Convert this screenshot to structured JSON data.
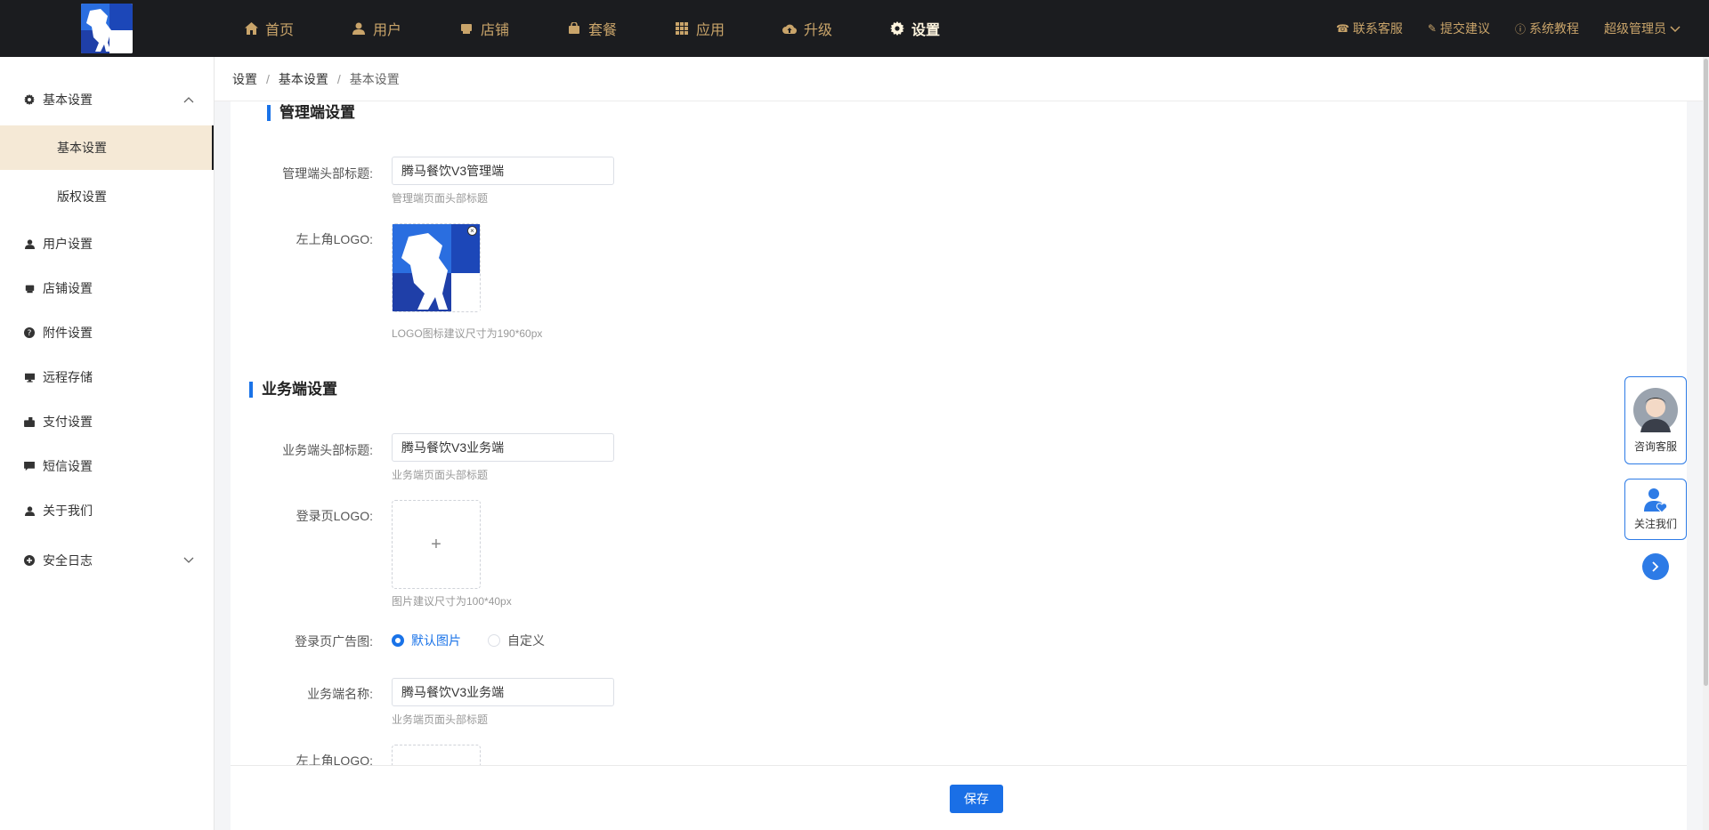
{
  "nav": {
    "items": [
      {
        "label": "首页",
        "icon": "home-icon"
      },
      {
        "label": "用户",
        "icon": "user-icon"
      },
      {
        "label": "店铺",
        "icon": "store-icon"
      },
      {
        "label": "套餐",
        "icon": "bag-icon"
      },
      {
        "label": "应用",
        "icon": "grid-icon"
      },
      {
        "label": "升级",
        "icon": "cloud-upload-icon"
      },
      {
        "label": "设置",
        "icon": "gear-icon",
        "active": true
      }
    ],
    "right": [
      {
        "label": "联系客服",
        "icon": "headset-icon"
      },
      {
        "label": "提交建议",
        "icon": "edit-icon"
      },
      {
        "label": "系统教程",
        "icon": "info-icon"
      }
    ],
    "user": "超级管理员"
  },
  "sidebar": {
    "groups": [
      {
        "label": "基本设置",
        "icon": "gear-icon",
        "expanded": true
      },
      {
        "label": "用户设置",
        "icon": "user-icon"
      },
      {
        "label": "店铺设置",
        "icon": "store-icon"
      },
      {
        "label": "附件设置",
        "icon": "question-icon"
      },
      {
        "label": "远程存储",
        "icon": "monitor-icon"
      },
      {
        "label": "支付设置",
        "icon": "wallet-icon"
      },
      {
        "label": "短信设置",
        "icon": "message-icon"
      },
      {
        "label": "关于我们",
        "icon": "user-icon"
      },
      {
        "label": "安全日志",
        "icon": "plus-circle-icon"
      }
    ],
    "subs": [
      {
        "label": "基本设置",
        "active": true
      },
      {
        "label": "版权设置"
      }
    ]
  },
  "breadcrumb": [
    "设置",
    "基本设置",
    "基本设置"
  ],
  "admin_section": {
    "title": "管理端设置",
    "header_title_label": "管理端头部标题:",
    "header_title_value": "腾马餐饮V3管理端",
    "header_title_hint": "管理端页面头部标题",
    "logo_label": "左上角LOGO:",
    "logo_hint": "LOGO图标建议尺寸为190*60px"
  },
  "biz_section": {
    "title": "业务端设置",
    "header_title_label": "业务端头部标题:",
    "header_title_value": "腾马餐饮V3业务端",
    "header_title_hint": "业务端页面头部标题",
    "login_logo_label": "登录页LOGO:",
    "login_logo_hint": "图片建议尺寸为100*40px",
    "ad_label": "登录页广告图:",
    "ad_options": [
      "默认图片",
      "自定义"
    ],
    "ad_selected": 0,
    "name_label": "业务端名称:",
    "name_value": "腾马餐饮V3业务端",
    "name_hint": "业务端页面头部标题",
    "corner_logo_label": "左上角LOGO:"
  },
  "footer": {
    "save_label": "保存"
  },
  "floating": {
    "service_label": "咨询客服",
    "follow_label": "关注我们"
  },
  "colors": {
    "accent": "#1a73e8",
    "nav_bg": "#1b1c1f",
    "nav_text": "#c9a46a",
    "active_sub_bg": "#f5e9d6"
  }
}
